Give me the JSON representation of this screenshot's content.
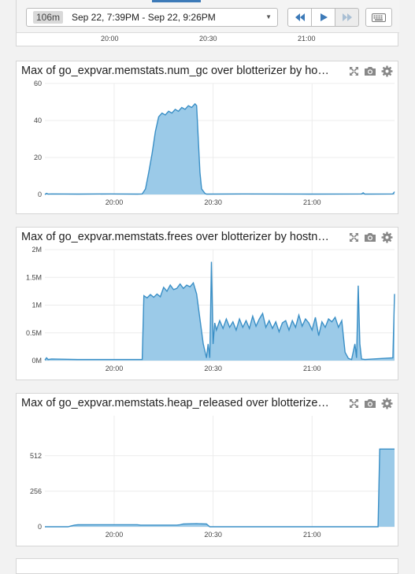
{
  "time_bar": {
    "duration": "106m",
    "range": "Sep 22, 7:39PM - Sep 22, 9:26PM",
    "icons": [
      "rewind-icon",
      "play-icon",
      "fast-forward-icon",
      "keyboard-icon",
      "caret-down-icon"
    ]
  },
  "top_axis": [
    "20:00",
    "20:30",
    "21:00"
  ],
  "panel_icons": [
    "fullscreen-icon",
    "camera-icon",
    "gear-icon"
  ],
  "colors": {
    "line": "#3a8fc6",
    "fill": "#9bcae8",
    "grid": "#ececec",
    "accent": "#3d7ab8"
  },
  "panels": [
    {
      "title": "Max of go_expvar.memstats.num_gc over blotterizer by hostname"
    },
    {
      "title": "Max of go_expvar.memstats.frees over blotterizer by hostname"
    },
    {
      "title": "Max of go_expvar.memstats.heap_released over blotterizer by hostname"
    }
  ],
  "chart_data": [
    {
      "type": "area",
      "x_unit": "minutes since 19:39",
      "xticks": [
        {
          "v": 21,
          "label": "20:00"
        },
        {
          "v": 51,
          "label": "20:30"
        },
        {
          "v": 81,
          "label": "21:00"
        }
      ],
      "yticks": [
        {
          "v": 0,
          "label": "0"
        },
        {
          "v": 20,
          "label": "20"
        },
        {
          "v": 40,
          "label": "40"
        },
        {
          "v": 60,
          "label": "60"
        }
      ],
      "xlim": [
        0,
        106
      ],
      "ylim": [
        0,
        60
      ],
      "points": [
        [
          0,
          0
        ],
        [
          0.5,
          0.6
        ],
        [
          1,
          0.2
        ],
        [
          2,
          0.3
        ],
        [
          10,
          0.2
        ],
        [
          20,
          0.3
        ],
        [
          28,
          0.2
        ],
        [
          29.5,
          0.3
        ],
        [
          30.5,
          3
        ],
        [
          31.5,
          12
        ],
        [
          32.5,
          22
        ],
        [
          33.5,
          34
        ],
        [
          34.5,
          42
        ],
        [
          35.5,
          44
        ],
        [
          36.5,
          43
        ],
        [
          37.5,
          45
        ],
        [
          38.5,
          44
        ],
        [
          39.5,
          46
        ],
        [
          40.5,
          45
        ],
        [
          41.5,
          47
        ],
        [
          42.5,
          46
        ],
        [
          43.5,
          48
        ],
        [
          44.5,
          47
        ],
        [
          45.5,
          49
        ],
        [
          46,
          48
        ],
        [
          46.5,
          30
        ],
        [
          47,
          12
        ],
        [
          47.5,
          3
        ],
        [
          48.5,
          0.6
        ],
        [
          49,
          0.2
        ],
        [
          60,
          0.3
        ],
        [
          80,
          0.2
        ],
        [
          96,
          0.3
        ],
        [
          96.5,
          0.9
        ],
        [
          97,
          0.2
        ],
        [
          105.5,
          0.3
        ],
        [
          106,
          1.5
        ]
      ]
    },
    {
      "type": "area",
      "x_unit": "minutes since 19:39",
      "xticks": [
        {
          "v": 21,
          "label": "20:00"
        },
        {
          "v": 51,
          "label": "20:30"
        },
        {
          "v": 81,
          "label": "21:00"
        }
      ],
      "yticks": [
        {
          "v": 0,
          "label": "0M"
        },
        {
          "v": 0.5,
          "label": "0.5M"
        },
        {
          "v": 1,
          "label": "1M"
        },
        {
          "v": 1.5,
          "label": "1.5M"
        },
        {
          "v": 2,
          "label": "2M"
        }
      ],
      "xlim": [
        0,
        106
      ],
      "ylim": [
        0,
        2
      ],
      "points": [
        [
          0,
          0.01
        ],
        [
          0.5,
          0.05
        ],
        [
          1,
          0.02
        ],
        [
          2,
          0.03
        ],
        [
          10,
          0.02
        ],
        [
          20,
          0.02
        ],
        [
          28,
          0.02
        ],
        [
          29.5,
          0.02
        ],
        [
          30,
          1.17
        ],
        [
          31,
          1.13
        ],
        [
          32,
          1.19
        ],
        [
          33,
          1.14
        ],
        [
          34,
          1.2
        ],
        [
          35,
          1.15
        ],
        [
          36,
          1.32
        ],
        [
          37,
          1.25
        ],
        [
          38,
          1.36
        ],
        [
          39,
          1.28
        ],
        [
          40,
          1.3
        ],
        [
          41,
          1.38
        ],
        [
          42,
          1.3
        ],
        [
          43,
          1.36
        ],
        [
          44,
          1.33
        ],
        [
          45,
          1.4
        ],
        [
          46,
          1.2
        ],
        [
          47,
          0.75
        ],
        [
          48,
          0.3
        ],
        [
          49,
          0.05
        ],
        [
          49.5,
          0.3
        ],
        [
          50,
          0.05
        ],
        [
          50.5,
          1.78
        ],
        [
          51,
          0.3
        ],
        [
          51.5,
          0.68
        ],
        [
          52,
          0.55
        ],
        [
          53,
          0.72
        ],
        [
          54,
          0.58
        ],
        [
          55,
          0.75
        ],
        [
          56,
          0.6
        ],
        [
          57,
          0.7
        ],
        [
          58,
          0.55
        ],
        [
          59,
          0.75
        ],
        [
          60,
          0.6
        ],
        [
          61,
          0.72
        ],
        [
          62,
          0.58
        ],
        [
          63,
          0.8
        ],
        [
          64,
          0.62
        ],
        [
          65,
          0.75
        ],
        [
          66,
          0.85
        ],
        [
          67,
          0.6
        ],
        [
          68,
          0.72
        ],
        [
          69,
          0.58
        ],
        [
          70,
          0.7
        ],
        [
          71,
          0.52
        ],
        [
          72,
          0.68
        ],
        [
          73,
          0.72
        ],
        [
          74,
          0.55
        ],
        [
          75,
          0.72
        ],
        [
          76,
          0.6
        ],
        [
          77,
          0.82
        ],
        [
          78,
          0.62
        ],
        [
          79,
          0.75
        ],
        [
          80,
          0.68
        ],
        [
          81,
          0.55
        ],
        [
          82,
          0.78
        ],
        [
          83,
          0.45
        ],
        [
          84,
          0.7
        ],
        [
          85,
          0.6
        ],
        [
          86,
          0.75
        ],
        [
          87,
          0.7
        ],
        [
          88,
          0.78
        ],
        [
          89,
          0.6
        ],
        [
          90,
          0.72
        ],
        [
          91,
          0.15
        ],
        [
          92,
          0.04
        ],
        [
          93,
          0.02
        ],
        [
          94,
          0.3
        ],
        [
          94.5,
          0.05
        ],
        [
          95,
          1.35
        ],
        [
          95.5,
          0.3
        ],
        [
          96,
          0.03
        ],
        [
          97,
          0.02
        ],
        [
          105.5,
          0.05
        ],
        [
          106,
          1.2
        ]
      ]
    },
    {
      "type": "area",
      "x_unit": "minutes since 19:39",
      "xticks": [
        {
          "v": 21,
          "label": "20:00"
        },
        {
          "v": 51,
          "label": "20:30"
        },
        {
          "v": 81,
          "label": "21:00"
        }
      ],
      "yticks": [
        {
          "v": 0,
          "label": "0"
        },
        {
          "v": 256,
          "label": "256"
        },
        {
          "v": 512,
          "label": "512"
        }
      ],
      "xlim": [
        0,
        106
      ],
      "ylim": [
        0,
        800
      ],
      "points": [
        [
          0,
          0
        ],
        [
          7,
          0
        ],
        [
          8,
          6
        ],
        [
          9,
          12
        ],
        [
          10,
          14
        ],
        [
          24,
          15
        ],
        [
          28,
          15
        ],
        [
          29,
          12
        ],
        [
          40,
          12
        ],
        [
          41,
          15
        ],
        [
          42,
          20
        ],
        [
          46,
          22
        ],
        [
          49,
          20
        ],
        [
          50,
          0
        ],
        [
          100,
          0
        ],
        [
          101,
          0
        ],
        [
          101.5,
          560
        ],
        [
          106,
          560
        ]
      ]
    }
  ]
}
